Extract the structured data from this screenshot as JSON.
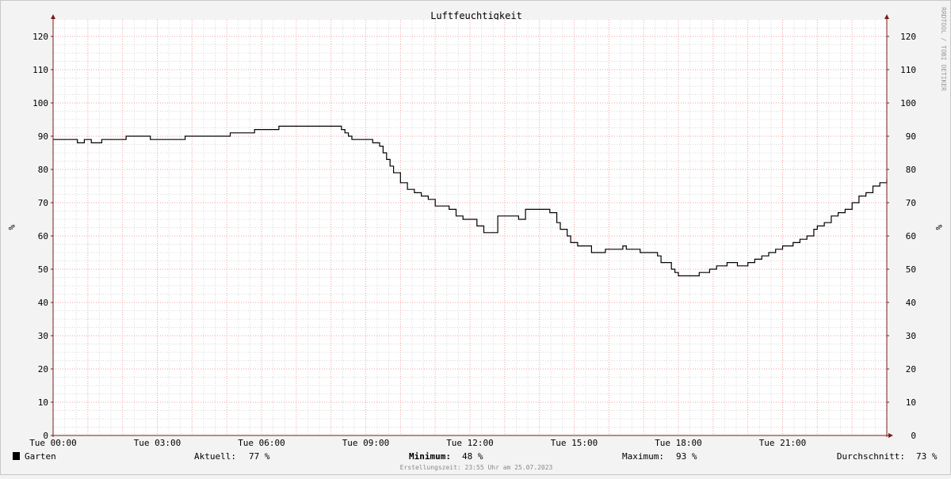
{
  "chart_data": {
    "type": "line",
    "title": "Luftfeuchtigkeit",
    "ylabel": "%",
    "ylim": [
      0,
      125
    ],
    "yticks": [
      0,
      10,
      20,
      30,
      40,
      50,
      60,
      70,
      80,
      90,
      100,
      110,
      120
    ],
    "xlim": [
      0,
      24
    ],
    "xtick_values": [
      0,
      3,
      6,
      9,
      12,
      15,
      18,
      21
    ],
    "xtick_labels": [
      "Tue 00:00",
      "Tue 03:00",
      "Tue 06:00",
      "Tue 09:00",
      "Tue 12:00",
      "Tue 15:00",
      "Tue 18:00",
      "Tue 21:00"
    ],
    "grid": true,
    "series": [
      {
        "name": "Garten",
        "color": "#000000",
        "x": [
          0,
          0.7,
          0.8,
          0.9,
          1.0,
          1.1,
          1.2,
          1.3,
          1.4,
          1.5,
          2.1,
          2.8,
          3.8,
          5.1,
          5.8,
          6.5,
          8.3,
          8.4,
          8.5,
          8.6,
          8.8,
          9.2,
          9.4,
          9.5,
          9.6,
          9.7,
          9.8,
          10.0,
          10.2,
          10.4,
          10.6,
          10.8,
          11.0,
          11.2,
          11.4,
          11.6,
          11.8,
          11.9,
          12.0,
          12.2,
          12.4,
          12.8,
          13.2,
          13.4,
          13.6,
          14.1,
          14.3,
          14.5,
          14.6,
          14.8,
          14.9,
          15.1,
          15.5,
          15.9,
          16.4,
          16.5,
          16.9,
          17.4,
          17.5,
          17.8,
          17.9,
          18.0,
          18.4,
          18.6,
          18.9,
          19.1,
          19.4,
          19.7,
          20.0,
          20.2,
          20.4,
          20.6,
          20.8,
          21.0,
          21.3,
          21.5,
          21.7,
          21.9,
          22.0,
          22.2,
          22.4,
          22.6,
          22.8,
          23.0,
          23.2,
          23.4,
          23.6,
          23.8,
          24.0
        ],
        "values": [
          89,
          88,
          88,
          89,
          89,
          88,
          88,
          88,
          89,
          89,
          90,
          89,
          90,
          91,
          92,
          93,
          92,
          91,
          90,
          89,
          89,
          88,
          87,
          85,
          83,
          81,
          79,
          76,
          74,
          73,
          72,
          71,
          69,
          69,
          68,
          66,
          65,
          65,
          65,
          63,
          61,
          66,
          66,
          65,
          68,
          68,
          67,
          64,
          62,
          60,
          58,
          57,
          55,
          56,
          57,
          56,
          55,
          54,
          52,
          50,
          49,
          48,
          48,
          49,
          50,
          51,
          52,
          51,
          52,
          53,
          54,
          55,
          56,
          57,
          58,
          59,
          60,
          62,
          63,
          64,
          66,
          67,
          68,
          70,
          72,
          73,
          75,
          76,
          77
        ]
      }
    ]
  },
  "watermark": "RRDTOOL / TOBI OETIKER",
  "legend": {
    "series_name": "Garten",
    "swatch_color": "#000000",
    "current_label": "Aktuell:",
    "current_value": "77 %",
    "min_label": "Minimum:",
    "min_value": "48 %",
    "max_label": "Maximum:",
    "max_value": "93 %",
    "avg_label": "Durchschnitt:",
    "avg_value": "73 %"
  },
  "footer": "Erstellungszeit: 23:55 Uhr am 25.07.2023",
  "colors": {
    "background": "#f3f3f3",
    "plot_background": "#ffffff",
    "major_grid": "#f0a0a0",
    "minor_grid": "#d8d8d8",
    "axis": "#7a1a1a",
    "line": "#000000"
  }
}
